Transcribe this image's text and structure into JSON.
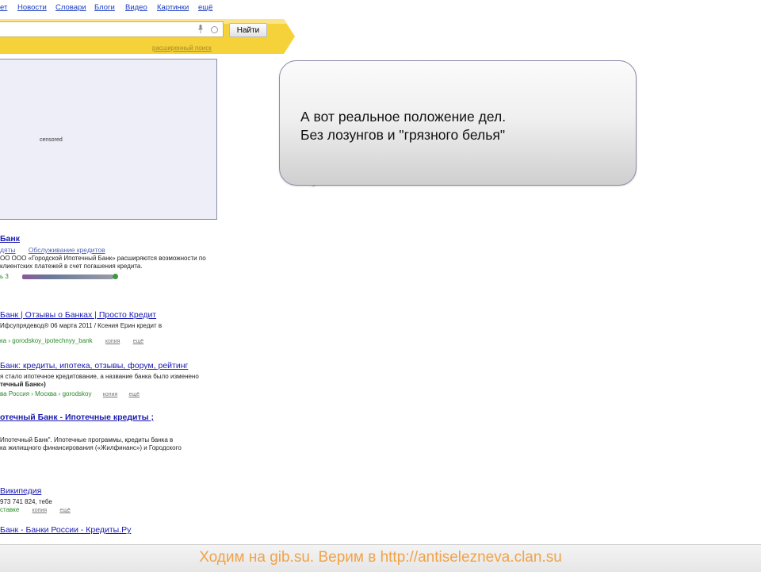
{
  "nav": {
    "items": [
      "ет",
      "Новости",
      "Словари",
      "Блоги",
      "Видео",
      "Картинки",
      "ещё"
    ]
  },
  "search": {
    "button_label": "Найти",
    "advanced_link": "расширенный поиск"
  },
  "censored_label": "censored",
  "bubble": {
    "line1": "А вот реальное положение дел.",
    "line2": "Без лозунгов и \"грязного белья\""
  },
  "results": [
    {
      "title": "Банк",
      "sublinks": [
        "дяты",
        "Обслуживание кредитов"
      ],
      "snippet1": "ОО ООО «Городской Ипотечный Банк» расширяются возможности по",
      "snippet2": "клиентских платежей в счет погашения кредита.",
      "url": "ь 3"
    },
    {
      "title": "Банк | Отзывы о Банках | Просто Кредит",
      "snippet1": "Ифсупрядевод® 06 марта 2011 / Ксения Ерин кредит в",
      "url": "ка › gorodskoy_ipotechnyy_bank",
      "copy": "копия",
      "more": "ещё"
    },
    {
      "title": "Банк: кредиты, ипотека, отзывы, форум, рейтинг",
      "snippet1": "я стало ипотечное кредитование, а название банка было изменено",
      "snippet2": "течный Банк»)",
      "url": "ва Россия › Москва › gorodskoy",
      "copy": "копия",
      "more": "ещё"
    },
    {
      "title": "отечный Банк - Ипотечные кредиты ;",
      "snippet1": "Ипотечный Банк\". Ипотечные программы, кредиты банка в",
      "snippet2": "ка жилищного финансирования («Жилфинанс») и Городского"
    },
    {
      "title": "Википедия",
      "snippet1": "973 741 824, тебе",
      "url": "ставке",
      "copy": "копия",
      "more": "ещё"
    },
    {
      "title": "Банк - Банки России - Кредиты.Ру"
    }
  ],
  "footer": {
    "text": "Ходим на gib.su. Верим в http://antiselezneva.clan.su"
  },
  "colors": {
    "search_band": "#f6d23a",
    "link": "#1a1ab0",
    "green_url": "#2a8a2a",
    "footer_text": "#f0a34a",
    "bubble_border": "#8a88a8"
  }
}
